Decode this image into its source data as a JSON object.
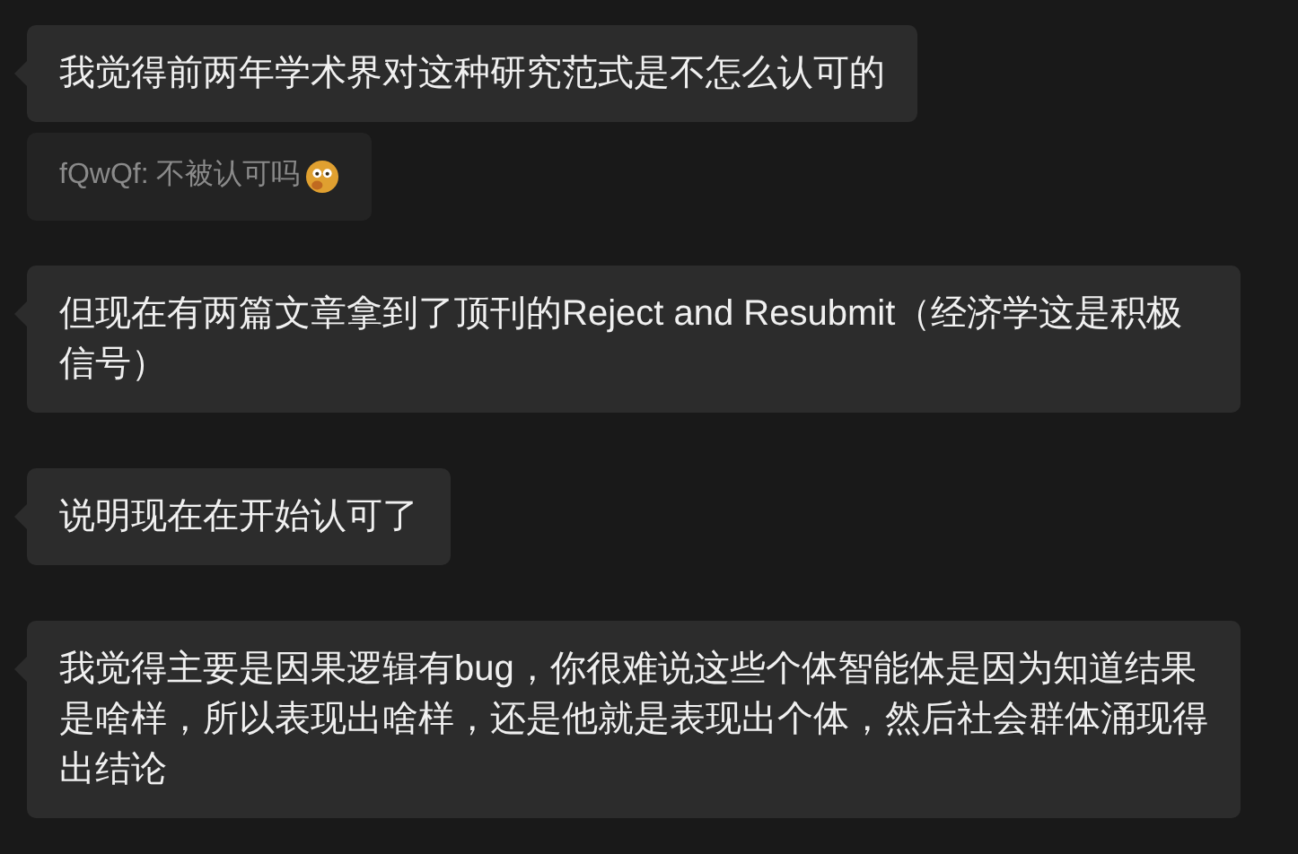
{
  "messages": [
    {
      "text": "我觉得前两年学术界对这种研究范式是不怎么认可的",
      "quote": {
        "text": "fQwQf: 不被认可吗",
        "emoji": true
      }
    },
    {
      "text": "但现在有两篇文章拿到了顶刊的Reject and Resubmit（经济学这是积极信号）"
    },
    {
      "text": "说明现在在开始认可了"
    },
    {
      "text": "我觉得主要是因果逻辑有bug，你很难说这些个体智能体是因为知道结果是啥样，所以表现出啥样，还是他就是表现出个体，然后社会群体涌现得出结论"
    }
  ]
}
